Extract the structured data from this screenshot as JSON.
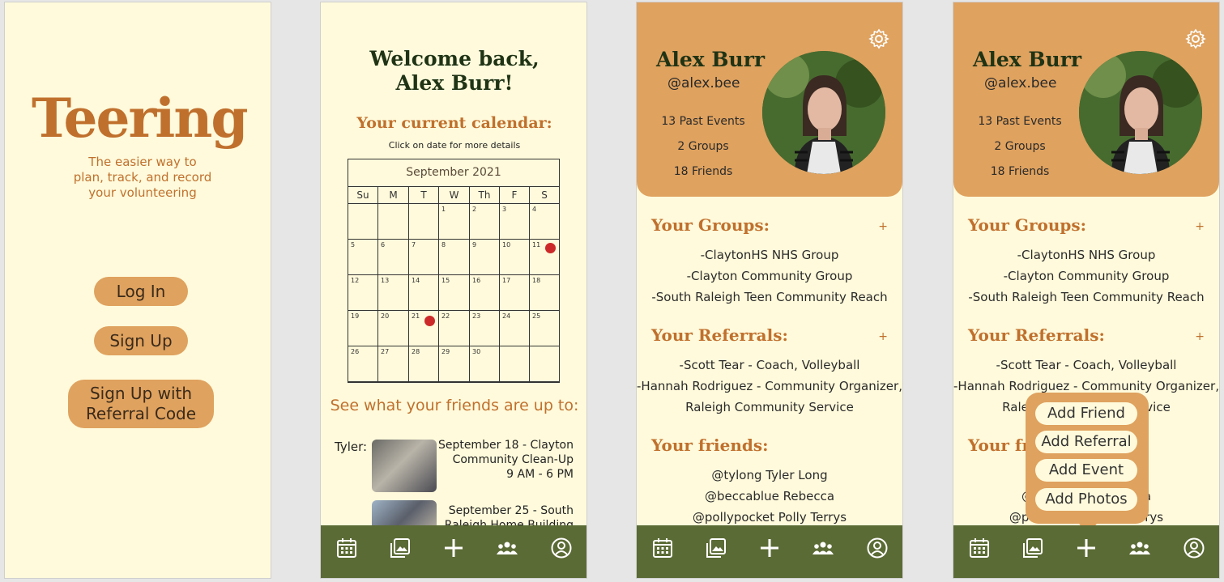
{
  "colors": {
    "cream": "#fffadb",
    "orange": "#c0702d",
    "tan": "#dfa25f",
    "olive": "#5b6b35",
    "red": "#cc2a2a",
    "darkgreen": "#1f3315"
  },
  "screen1": {
    "logo": "Teering",
    "tagline": [
      "The easier way to",
      "plan, track, and record",
      "your volunteering"
    ],
    "login": "Log In",
    "signup": "Sign Up",
    "referral_signup": [
      "Sign Up with",
      "Referral Code"
    ]
  },
  "screen2": {
    "welcome": [
      "Welcome back,",
      "Alex Burr!"
    ],
    "calendar_heading": "Your current calendar:",
    "calendar_hint": "Click on date for more details",
    "month": "September 2021",
    "weekdays": [
      "Su",
      "M",
      "T",
      "W",
      "Th",
      "F",
      "S"
    ],
    "days": [
      "",
      "",
      "",
      "1",
      "2",
      "3",
      "4",
      "5",
      "6",
      "7",
      "8",
      "9",
      "10",
      "11",
      "12",
      "13",
      "14",
      "15",
      "16",
      "17",
      "18",
      "19",
      "20",
      "21",
      "22",
      "23",
      "24",
      "25",
      "26",
      "27",
      "28",
      "29",
      "30",
      "",
      ""
    ],
    "event_days": [
      "11",
      "21"
    ],
    "friends_heading": "See what your friends are up to:",
    "friend_name": "Tyler:",
    "event1": [
      "September 18 - Clayton",
      "Community Clean-Up",
      "9 AM - 6 PM"
    ],
    "event2": [
      "September 25 -  South",
      "Raleigh Home Building"
    ]
  },
  "profile": {
    "name": "Alex Burr",
    "handle": "@alex.bee",
    "stats": [
      "13 Past Events",
      "2 Groups",
      "18 Friends"
    ],
    "groups_title": "Your Groups:",
    "groups": [
      "-ClaytonHS NHS Group",
      "-Clayton Community Group",
      "-South Raleigh Teen Community Reach"
    ],
    "referrals_title": "Your Referrals:",
    "referrals": [
      "-Scott Tear - Coach, Volleyball",
      "-Hannah Rodriguez - Community Organizer,",
      "Raleigh Community Service"
    ],
    "friends_title": "Your friends:",
    "friends": [
      "@tylong  Tyler Long",
      "@beccablue  Rebecca",
      "@pollypocket Polly Terrys"
    ],
    "plus": "+"
  },
  "popup": {
    "items": [
      "Add Friend",
      "Add Referral",
      "Add Event",
      "Add Photos"
    ]
  },
  "nav": {
    "icons": [
      "calendar-icon",
      "gallery-icon",
      "add-icon",
      "groups-icon",
      "profile-icon"
    ]
  }
}
